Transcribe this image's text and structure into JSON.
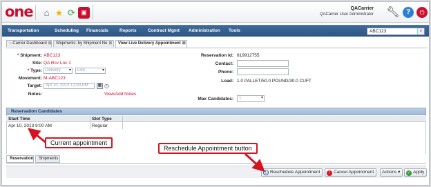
{
  "header": {
    "logo": "one",
    "user_name": "QACarrier",
    "user_role": "QACarrier User Administrator"
  },
  "nav": {
    "items": [
      "Transportation",
      "Scheduling",
      "Financials",
      "Reports",
      "Contract Mgmt",
      "Administration",
      "Tools"
    ],
    "search_value": "ABC123"
  },
  "tabs": [
    {
      "label": "Carrier Dashboard"
    },
    {
      "label": "Shipments: by Shipment No"
    },
    {
      "label": "View Live Delivery Appointment"
    }
  ],
  "form": {
    "shipment_label": "Shipment:",
    "shipment_value": "ABC123",
    "site_label": "Site:",
    "site_value": "QA Rcv Loc 1",
    "type_label": "Type:",
    "type_value_1": "Delivery",
    "type_value_2": "Live",
    "movement_label": "Movement:",
    "movement_value": "M-ABC123",
    "target_label": "Target:",
    "target_value": "Apr 10, 2013 12:00 PM",
    "notes_label": "Notes:",
    "notes_link": "View/Add Notes",
    "reservation_id_label": "Reservation Id:",
    "reservation_id_value": "819912755",
    "contact_label": "Contact:",
    "contact_value": "",
    "phone_label": "Phone:",
    "phone_value": "",
    "load_label": "Load:",
    "load_value": "1.0 PALLET/50.0 POUND/30.0 CUFT",
    "max_candidates_label": "Max Candidates:",
    "max_candidates_value": "1"
  },
  "grid": {
    "title": "Reservation Candidates",
    "columns": [
      "Start Time",
      "Slot Type"
    ],
    "rows": [
      {
        "start_time": "Apr 10, 2013 9:00 AM",
        "slot_type": "Regular"
      }
    ]
  },
  "bottom_tabs": [
    "Reservation",
    "Shipments"
  ],
  "actions": {
    "reschedule": "Reschedule Appointment",
    "cancel": "Cancel Appointment",
    "actions": "Actions",
    "apply": "Apply"
  },
  "annotations": {
    "current": "Current appointment",
    "reschedule": "Reschedule Appointment button"
  },
  "colors": {
    "accent_red": "#c8102e",
    "nav_blue": "#2c5584",
    "callout_red": "#d6141f"
  }
}
